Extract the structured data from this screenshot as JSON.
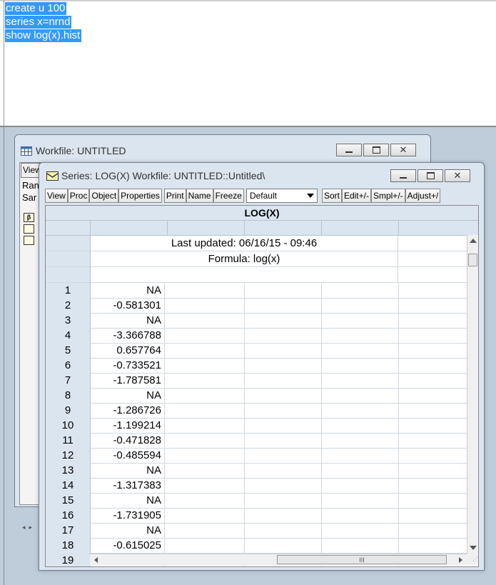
{
  "command_window": {
    "lines": [
      "create u 100",
      "series x=nrnd",
      "show log(x).hist"
    ]
  },
  "workfile_window": {
    "title": "Workfile: UNTITLED",
    "view_label": "View",
    "range_label": "Ran",
    "sample_label": "Sar",
    "minimize_icon": "minimize-icon",
    "maximize_icon": "maximize-icon",
    "close_icon": "close-icon"
  },
  "series_window": {
    "title": "Series: LOG(X)   Workfile: UNTITLED::Untitled\\",
    "toolbar": [
      "View",
      "Proc",
      "Object",
      "Properties",
      "Print",
      "Name",
      "Freeze"
    ],
    "dropdown_value": "Default",
    "toolbar_right": [
      "Sort",
      "Edit+/-",
      "Smpl+/-",
      "Adjust+/"
    ],
    "grid_title": "LOG(X)",
    "last_updated": "Last updated: 06/16/15 - 09:46",
    "formula": "Formula: log(x)",
    "rows": [
      {
        "n": "1",
        "v": "NA"
      },
      {
        "n": "2",
        "v": "-0.581301"
      },
      {
        "n": "3",
        "v": "NA"
      },
      {
        "n": "4",
        "v": "-3.366788"
      },
      {
        "n": "5",
        "v": "0.657764"
      },
      {
        "n": "6",
        "v": "-0.733521"
      },
      {
        "n": "7",
        "v": "-1.787581"
      },
      {
        "n": "8",
        "v": "NA"
      },
      {
        "n": "9",
        "v": "-1.286726"
      },
      {
        "n": "10",
        "v": "-1.199214"
      },
      {
        "n": "11",
        "v": "-0.471828"
      },
      {
        "n": "12",
        "v": "-0.485594"
      },
      {
        "n": "13",
        "v": "NA"
      },
      {
        "n": "14",
        "v": "-1.317383"
      },
      {
        "n": "15",
        "v": "NA"
      },
      {
        "n": "16",
        "v": "-1.731905"
      },
      {
        "n": "17",
        "v": "NA"
      },
      {
        "n": "18",
        "v": "-0.615025"
      },
      {
        "n": "19",
        "v": ""
      }
    ],
    "hscroll_thumb_label": "III"
  },
  "colors": {
    "selection": "#3399ff",
    "window_frame": "#dbe5f0",
    "workspace": "#bfcddb"
  }
}
